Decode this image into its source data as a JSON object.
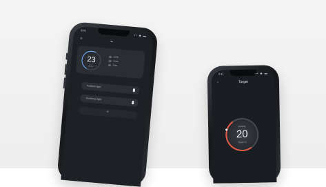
{
  "phone_left": {
    "status": {
      "time": "9:41",
      "icons": "▪▪ ◆ ▬"
    },
    "header": {
      "menu_icon": "menu-icon",
      "logo_glyph": "⌁"
    },
    "dial": {
      "value": "23",
      "sub": "Zone"
    },
    "stats": [
      {
        "label": "21%"
      },
      {
        "label": "Auto"
      },
      {
        "label": "Fan"
      }
    ],
    "controls": [
      {
        "label": "Ambient light"
      },
      {
        "label": "Overhead light"
      }
    ],
    "add_label": "+"
  },
  "phone_right": {
    "status": {
      "time": "9:41",
      "icons": "▪▪ ◆ ▬"
    },
    "title": "Target",
    "back_glyph": "‹",
    "target": {
      "caption_top": "Heating",
      "value": "20",
      "caption_bottom": "Target °C"
    },
    "accent_color": "#e35a4a"
  }
}
